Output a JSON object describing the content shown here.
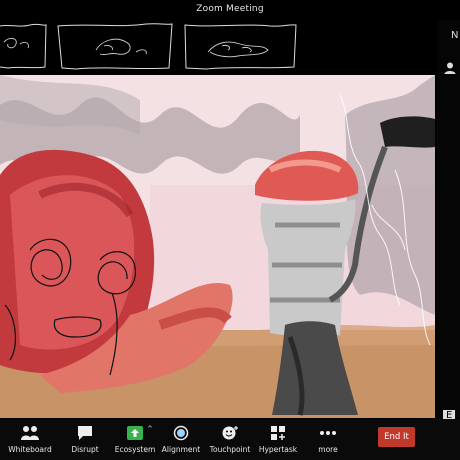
{
  "window": {
    "title": "Zoom Meeting"
  },
  "thumbnails": [
    {
      "id": "thumb-1"
    },
    {
      "id": "thumb-2"
    },
    {
      "id": "thumb-3"
    }
  ],
  "right_panel": {
    "label": "N",
    "edge_label": "E"
  },
  "toolbar": {
    "items": [
      {
        "label": "Whiteboard",
        "icon": "participants-icon"
      },
      {
        "label": "Disrupt",
        "icon": "chat-bubble-icon"
      },
      {
        "label": "Ecosystem",
        "icon": "share-up-arrow-icon"
      },
      {
        "label": "Alignment",
        "icon": "circle-record-icon"
      },
      {
        "label": "Touchpoint",
        "icon": "smiley-reaction-icon"
      },
      {
        "label": "Hypertask",
        "icon": "apps-icon"
      },
      {
        "label": "more",
        "icon": "more-dots-icon"
      }
    ],
    "end_label": "End It"
  },
  "colors": {
    "end_button": "#c0392b",
    "background": "#000000"
  }
}
